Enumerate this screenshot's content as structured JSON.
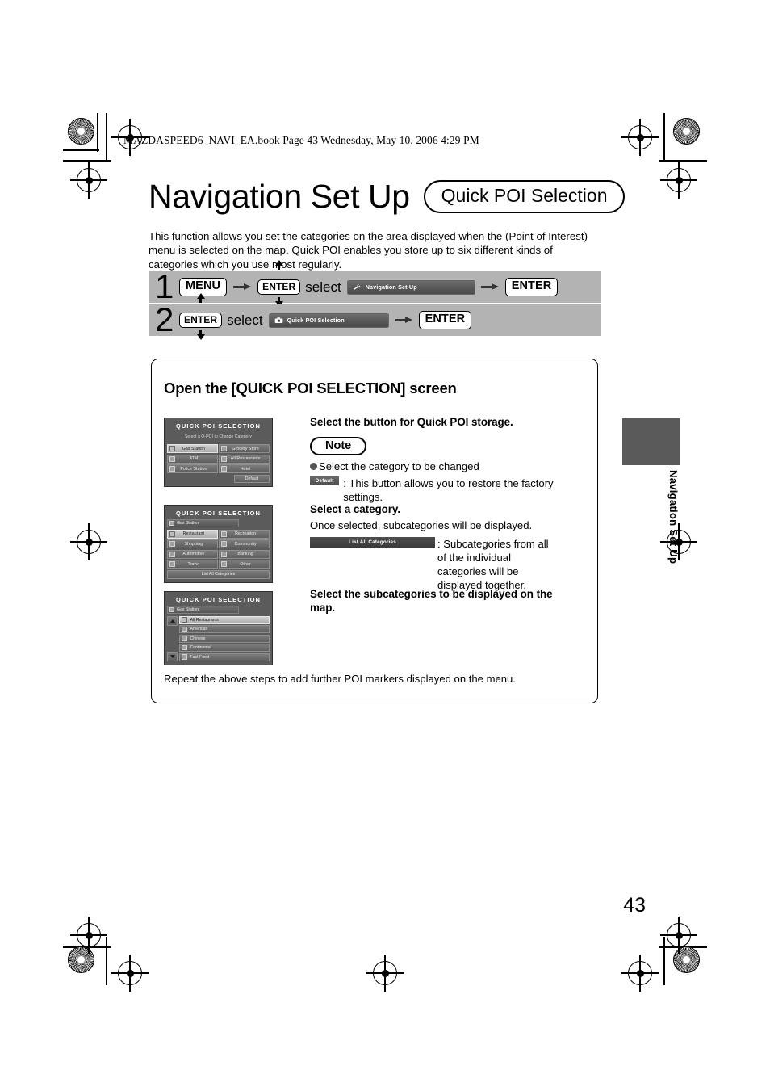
{
  "header": {
    "file_line": "MAZDASPEED6_NAVI_EA.book  Page 43  Wednesday, May 10, 2006  4:29 PM"
  },
  "title": {
    "main": "Navigation Set Up",
    "pill": "Quick POI Selection"
  },
  "intro": "This function allows you set the categories on the area displayed when the (Point of Interest) menu is selected on the map. Quick POI enables you store up to six different kinds of categories which you use most regularly.",
  "steps": [
    {
      "number": "1",
      "key1": "MENU",
      "key2": "ENTER",
      "select_word": "select",
      "chip": "Navigation Set Up",
      "chip_icon": "wrench-icon",
      "key3": "ENTER"
    },
    {
      "number": "2",
      "key1": "ENTER",
      "select_word": "select",
      "chip": "Quick POI Selection",
      "chip_icon": "camera-icon",
      "key3": "ENTER"
    }
  ],
  "content": {
    "section_heading": "Open the [QUICK POI SELECTION] screen",
    "instructions": [
      {
        "heading": "Select the button for Quick POI storage.",
        "note_label": "Note",
        "note_bullet": "Select the category to be changed",
        "note_button": "Default",
        "note_button_text": ": This button allows you to restore the factory settings."
      },
      {
        "heading": "Select a category.",
        "body": "Once selected, subcategories will be displayed.",
        "wide_button": "List All Categories",
        "wide_button_text": ": Subcategories from all of the individual categories will be displayed together."
      },
      {
        "heading": "Select the subcategories to be displayed on the map."
      }
    ],
    "repeat_note": "Repeat the above steps to add further POI markers displayed on the menu."
  },
  "screens": [
    {
      "title": "QUICK POI SELECTION",
      "subtitle": "Select a Q-POI to Change Category",
      "buttons": [
        {
          "label": "Gas Station",
          "selected": true
        },
        {
          "label": "Grocery Store",
          "selected": false
        },
        {
          "label": "ATM",
          "selected": false
        },
        {
          "label": "All Restaurants",
          "selected": false
        },
        {
          "label": "Police Station",
          "selected": false
        },
        {
          "label": "Hotel",
          "selected": false
        }
      ],
      "default_button": "Default"
    },
    {
      "title": "QUICK POI SELECTION",
      "breadcrumb": "Gas Station",
      "buttons": [
        {
          "label": "Restaurant",
          "selected": true
        },
        {
          "label": "Recreation",
          "selected": false
        },
        {
          "label": "Shopping",
          "selected": false
        },
        {
          "label": "Community",
          "selected": false
        },
        {
          "label": "Automotive",
          "selected": false
        },
        {
          "label": "Banking",
          "selected": false
        },
        {
          "label": "Travel",
          "selected": false
        },
        {
          "label": "Other",
          "selected": false
        }
      ],
      "full_button": "List All Categories"
    },
    {
      "title": "QUICK POI SELECTION",
      "breadcrumb": "Gas Station",
      "rows": [
        {
          "label": "All Restaurants",
          "selected": true
        },
        {
          "label": "American",
          "selected": false
        },
        {
          "label": "Chinese",
          "selected": false
        },
        {
          "label": "Continental",
          "selected": false
        },
        {
          "label": "Fast Food",
          "selected": false
        }
      ]
    }
  ],
  "side_tab": {
    "label": "Navigation Set Up"
  },
  "page_number": "43",
  "colors": {
    "step_band": "#b3b3b3",
    "nav_screen": "#5b5b5b",
    "side_tab": "#5a5a5a"
  }
}
